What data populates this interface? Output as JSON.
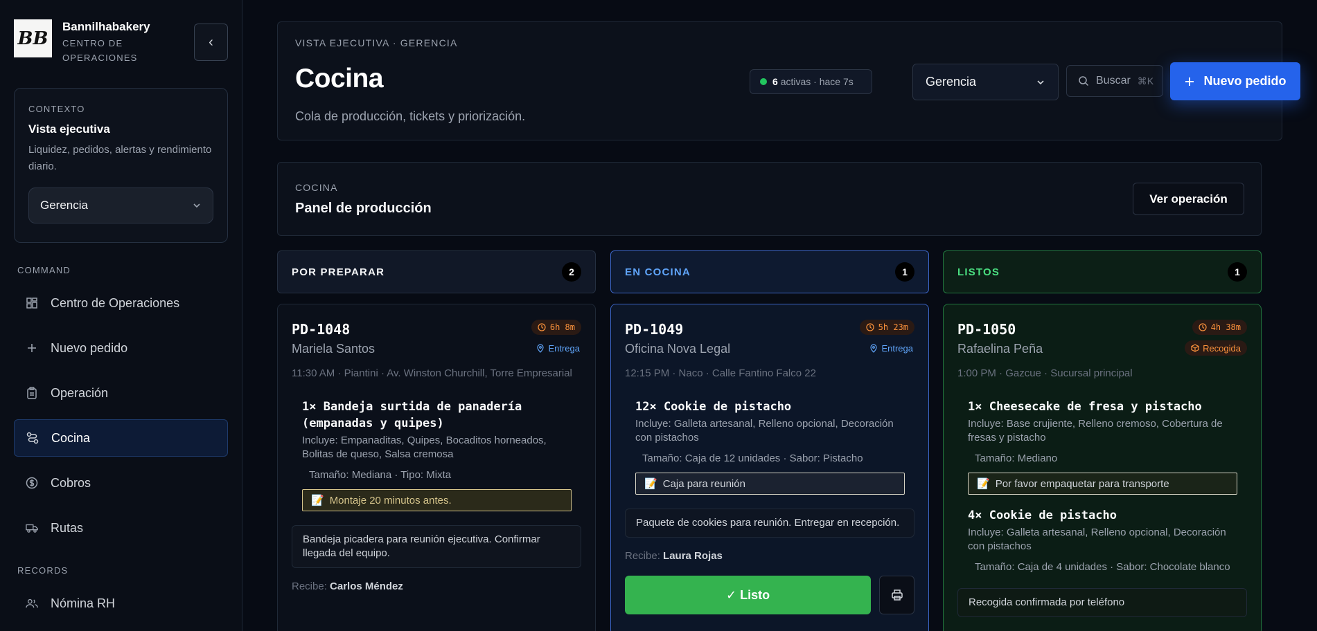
{
  "brand": {
    "name": "Bannilhabakery",
    "sub": "CENTRO DE OPERACIONES",
    "logo_text": "BB"
  },
  "context": {
    "label": "CONTEXTO",
    "title": "Vista ejecutiva",
    "desc": "Liquidez, pedidos, alertas y rendimiento diario.",
    "select_value": "Gerencia"
  },
  "nav": {
    "command_label": "COMMAND",
    "records_label": "RECORDS",
    "items": [
      {
        "label": "Centro de Operaciones",
        "icon": "dashboard-icon"
      },
      {
        "label": "Nuevo pedido",
        "icon": "plus-icon"
      },
      {
        "label": "Operación",
        "icon": "clipboard-icon"
      },
      {
        "label": "Cocina",
        "icon": "route-icon",
        "active": true
      },
      {
        "label": "Cobros",
        "icon": "dollar-icon"
      },
      {
        "label": "Rutas",
        "icon": "truck-icon"
      },
      {
        "label": "Nómina RH",
        "icon": "users-icon"
      }
    ]
  },
  "header": {
    "crumb": "VISTA EJECUTIVA · GERENCIA",
    "title": "Cocina",
    "desc": "Cola de producción, tickets y priorización.",
    "activity_count": "6",
    "activity_text": "activas · hace 7s",
    "role_value": "Gerencia",
    "search_placeholder": "Buscar",
    "search_kbd": "⌘K",
    "new_order_label": "Nuevo pedido"
  },
  "panel": {
    "sub": "COCINA",
    "title": "Panel de producción",
    "button": "Ver operación"
  },
  "columns": [
    {
      "title": "POR PREPARAR",
      "count": "2"
    },
    {
      "title": "EN COCINA",
      "count": "1"
    },
    {
      "title": "LISTOS",
      "count": "1"
    }
  ],
  "tickets": {
    "prep": {
      "id": "PD-1048",
      "client": "Mariela Santos",
      "timer": "6h 8m",
      "mode": "Entrega",
      "meta": "11:30 AM · Piantini · Av. Winston Churchill, Torre Empresarial",
      "item_name": "1× Bandeja surtida de panadería (empanadas y quipes)",
      "item_inc": "Incluye: Empanaditas, Quipes, Bocaditos horneados, Bolitas de queso, Salsa cremosa",
      "item_spec": "Tamaño: Mediana · Tipo: Mixta",
      "note": "Montaje 20 minutos antes.",
      "memo": "Bandeja picadera para reunión ejecutiva. Confirmar llegada del equipo.",
      "receiver_label": "Recibe:",
      "receiver": "Carlos Méndez"
    },
    "cook": {
      "id": "PD-1049",
      "client": "Oficina Nova Legal",
      "timer": "5h 23m",
      "mode": "Entrega",
      "meta": "12:15 PM · Naco · Calle Fantino Falco 22",
      "item_name": "12× Cookie de pistacho",
      "item_inc": "Incluye: Galleta artesanal, Relleno opcional, Decoración con pistachos",
      "item_spec": "Tamaño: Caja de 12 unidades · Sabor: Pistacho",
      "note": "Caja para reunión",
      "memo": "Paquete de cookies para reunión. Entregar en recepción.",
      "receiver_label": "Recibe:",
      "receiver": "Laura Rojas",
      "ready_button": "✓ Listo"
    },
    "ready": {
      "id": "PD-1050",
      "client": "Rafaelina Peña",
      "timer": "4h 38m",
      "mode": "Recogida",
      "meta": "1:00 PM · Gazcue · Sucursal principal",
      "item1_name": "1× Cheesecake de fresa y pistacho",
      "item1_inc": "Incluye: Base crujiente, Relleno cremoso, Cobertura de fresas y pistacho",
      "item1_spec": "Tamaño: Mediano",
      "note": "Por favor empaquetar para transporte",
      "item2_name": "4× Cookie de pistacho",
      "item2_inc": "Incluye: Galleta artesanal, Relleno opcional, Decoración con pistachos",
      "item2_spec": "Tamaño: Caja de 4 unidades · Sabor: Chocolate blanco",
      "memo": "Recogida confirmada por teléfono"
    }
  },
  "colors": {
    "accent": "#2563eb",
    "success": "#34b34f",
    "warning": "#fb923c",
    "info": "#60a5fa"
  }
}
